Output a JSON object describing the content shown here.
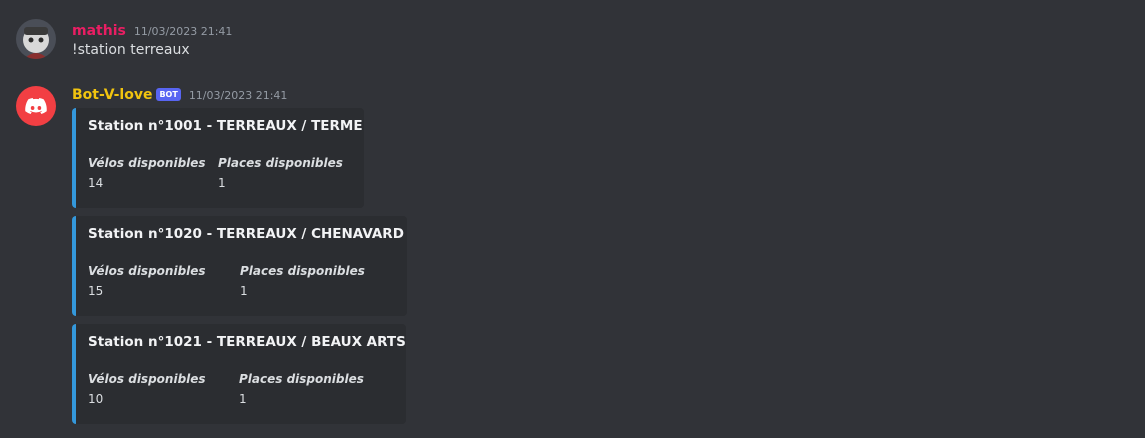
{
  "messages": [
    {
      "author": "mathis",
      "author_color": "#e91e63",
      "timestamp": "11/03/2023 21:41",
      "content": "!station terreaux"
    },
    {
      "author": "Bot-V-love",
      "author_color": "#f1c40f",
      "bot_tag": "BOT",
      "timestamp": "11/03/2023 21:41",
      "embed_color": "#3498db",
      "embeds": [
        {
          "title": "Station n°1001 - TERREAUX / TERME",
          "fields": [
            {
              "name": "Vélos disponibles",
              "value": "14"
            },
            {
              "name": "Places disponibles",
              "value": "1"
            }
          ]
        },
        {
          "title": "Station n°1020 - TERREAUX / CHENAVARD",
          "fields": [
            {
              "name": "Vélos disponibles",
              "value": "15"
            },
            {
              "name": "Places disponibles",
              "value": "1"
            }
          ]
        },
        {
          "title": "Station n°1021 - TERREAUX / BEAUX ARTS",
          "fields": [
            {
              "name": "Vélos disponibles",
              "value": "10"
            },
            {
              "name": "Places disponibles",
              "value": "1"
            }
          ]
        }
      ]
    }
  ],
  "avatars": {
    "user": "user-avatar",
    "bot": "discord-logo-icon"
  },
  "colors": {
    "background": "#313338",
    "embed_background": "#2b2d31",
    "bot_avatar": "#f23f43",
    "bot_tag": "#5865f2"
  }
}
